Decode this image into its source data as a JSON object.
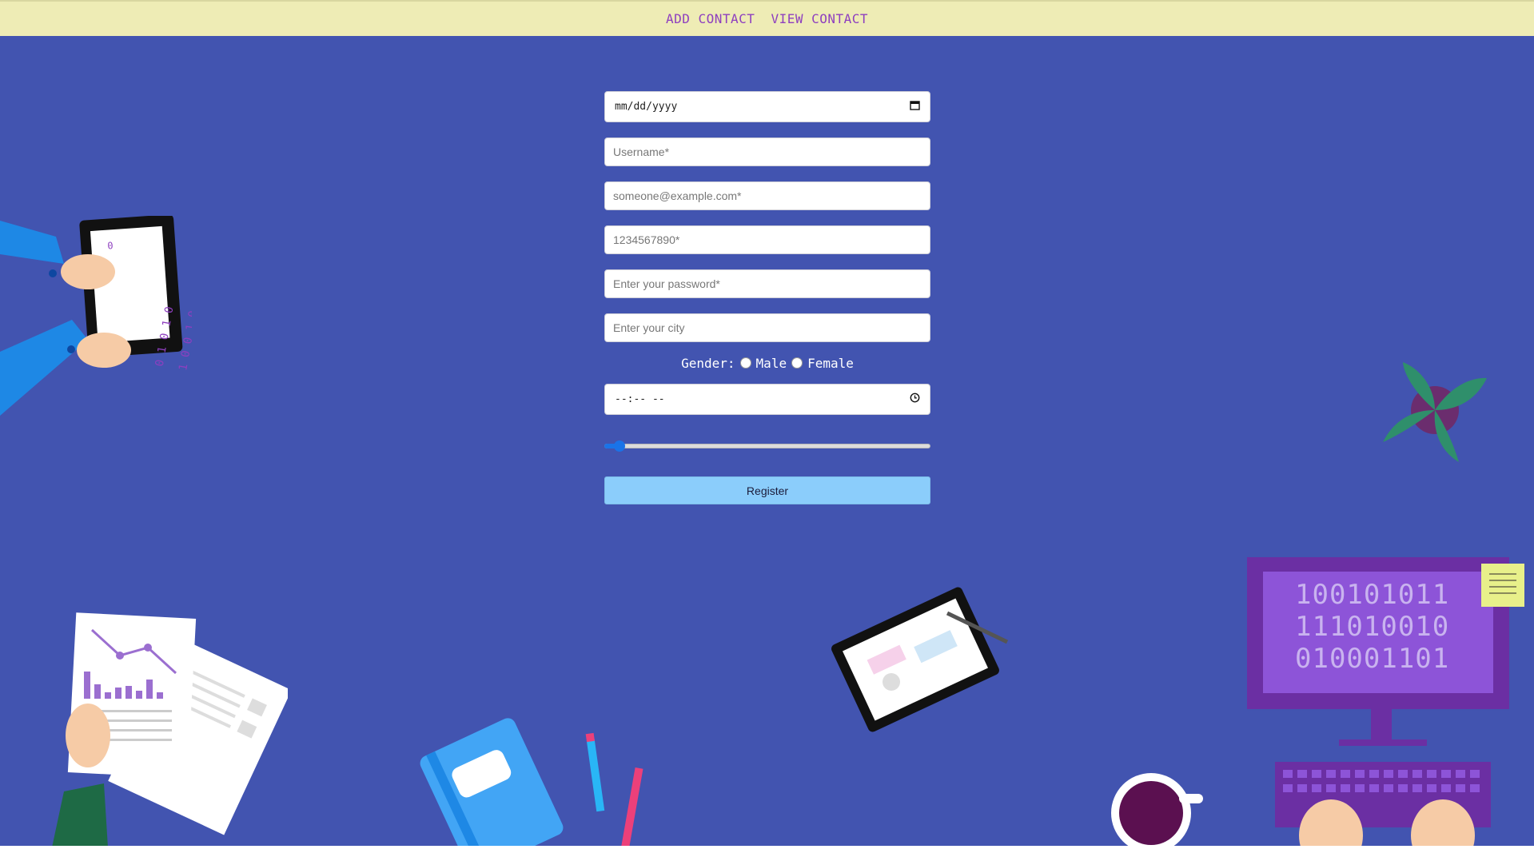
{
  "nav": {
    "links": [
      "ADD CONTACT",
      "VIEW CONTACT"
    ]
  },
  "form": {
    "date": {
      "value": "mm/dd/yyyy"
    },
    "username": {
      "placeholder": "Username*"
    },
    "email": {
      "placeholder": "someone@example.com*"
    },
    "phone": {
      "placeholder": "1234567890*"
    },
    "password": {
      "placeholder": "Enter your password*"
    },
    "city": {
      "placeholder": "Enter your city"
    },
    "gender": {
      "label": "Gender:",
      "options": [
        "Male",
        "Female"
      ]
    },
    "time": {
      "value": "--:-- --"
    },
    "range": {
      "value": 0.03
    },
    "submit_label": "Register"
  },
  "illustration": {
    "monitor_lines": [
      "100101011",
      "111010010",
      "010001101"
    ],
    "tablet_text": [
      "0 1 0 1 0",
      "1 0 0 1 0"
    ]
  },
  "colors": {
    "background": "#4254b0",
    "navbar": "#eeecb5",
    "nav_link": "#8e3fbf",
    "button": "#8bcdfb"
  }
}
